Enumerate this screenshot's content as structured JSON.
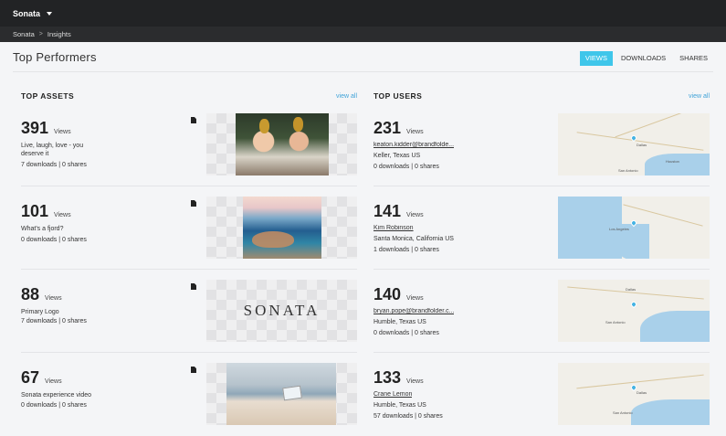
{
  "app": {
    "name": "Sonata"
  },
  "breadcrumb": {
    "root": "Sonata",
    "sep": ">",
    "current": "Insights"
  },
  "page": {
    "title": "Top Performers"
  },
  "tabs": [
    {
      "label": "VIEWS",
      "active": true
    },
    {
      "label": "DOWNLOADS",
      "active": false
    },
    {
      "label": "SHARES",
      "active": false
    }
  ],
  "colors": {
    "accent": "#3fc6ea",
    "link": "#3fa3d8",
    "topbar": "#222325"
  },
  "top_assets": {
    "title": "TOP ASSETS",
    "view_all": "view all",
    "items": [
      {
        "views": "391",
        "views_label": "Views",
        "title": "Live, laugh, love - you deserve it",
        "meta": "7 downloads | 0 shares",
        "icon": "document-icon"
      },
      {
        "views": "101",
        "views_label": "Views",
        "title": "What's a fjord?",
        "meta": "0 downloads | 0 shares",
        "icon": "document-icon"
      },
      {
        "views": "88",
        "views_label": "Views",
        "title": "Primary Logo",
        "meta": "7 downloads | 0 shares",
        "icon": "document-icon",
        "thumb_text": "SONATA"
      },
      {
        "views": "67",
        "views_label": "Views",
        "title": "Sonata experience video",
        "meta": "0 downloads | 0 shares",
        "icon": "document-icon"
      }
    ]
  },
  "top_users": {
    "title": "TOP USERS",
    "view_all": "view all",
    "items": [
      {
        "views": "231",
        "views_label": "Views",
        "name": "keaton.kidder@brandfolde...",
        "location": "Keller, Texas US",
        "meta": "0 downloads | 0 shares"
      },
      {
        "views": "141",
        "views_label": "Views",
        "name": "Kim Robinson",
        "location": "Santa Monica, California US",
        "meta": "1 downloads | 0 shares"
      },
      {
        "views": "140",
        "views_label": "Views",
        "name": "bryan.pope@brandfolder.c...",
        "location": "Humble, Texas US",
        "meta": "0 downloads | 0 shares"
      },
      {
        "views": "133",
        "views_label": "Views",
        "name": "Crane Lemon",
        "location": "Humble, Texas US",
        "meta": "57 downloads | 0 shares"
      }
    ]
  },
  "map_labels": {
    "a": "Dallas",
    "b": "Houston",
    "c": "San Antonio",
    "d": "Los Angeles"
  }
}
